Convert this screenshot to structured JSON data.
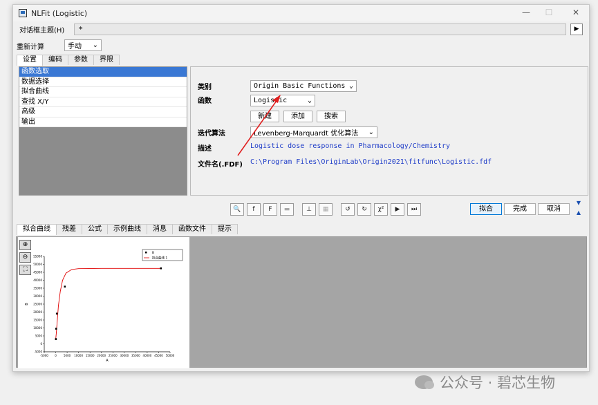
{
  "window": {
    "title": "NLFit (Logistic)",
    "minimize": "—",
    "maximize": "☐",
    "close": "✕"
  },
  "header": {
    "theme_label": "对话框主题(H)",
    "theme_value": "*",
    "recalc_label": "重新计算",
    "recalc_value": "手动"
  },
  "top_tabs": [
    "设置",
    "编码",
    "参数",
    "界限"
  ],
  "tree_items": [
    "函数选取",
    "数据选择",
    "拟合曲线",
    "查找 X/Y",
    "高级",
    "输出"
  ],
  "settings": {
    "category_label": "类别",
    "category_value": "Origin Basic Functions",
    "function_label": "函数",
    "function_value": "Logistic",
    "btn_new": "新建",
    "btn_add": "添加",
    "btn_search": "搜索",
    "algo_label": "迭代算法",
    "algo_value": "Levenberg-Marquardt 优化算法",
    "desc_label": "描述",
    "desc_value": "Logistic dose response in Pharmacology/Chemistry",
    "file_label": "文件名(.FDF)",
    "file_value": "C:\\Program Files\\OriginLab\\Origin2021\\fitfunc\\Logistic.fdf"
  },
  "actions": {
    "fit": "拟合",
    "done": "完成",
    "cancel": "取消"
  },
  "bottom_tabs": [
    "拟合曲线",
    "残差",
    "公式",
    "示例曲线",
    "消息",
    "函数文件",
    "提示"
  ],
  "watermark": "公众号 · 碧芯生物",
  "chart_data": {
    "type": "scatter",
    "xlabel": "A",
    "ylabel": "B",
    "xlim": [
      -5000,
      50000
    ],
    "ylim": [
      -5000,
      55000
    ],
    "x_ticks": [
      "-5000",
      "0",
      "5000",
      "10000",
      "15000",
      "20000",
      "25000",
      "30000",
      "35000",
      "40000",
      "45000",
      "50000"
    ],
    "y_ticks": [
      "-5000",
      "0",
      "5000",
      "10000",
      "15000",
      "20000",
      "25000",
      "30000",
      "35000",
      "40000",
      "45000",
      "50000",
      "55000"
    ],
    "legend": [
      "B",
      "拟合曲线 1"
    ],
    "points": [
      [
        100,
        3000
      ],
      [
        200,
        9500
      ],
      [
        500,
        19000
      ],
      [
        4000,
        36000
      ],
      [
        46000,
        47500
      ]
    ],
    "fit_curve": [
      [
        0,
        2500
      ],
      [
        300,
        7000
      ],
      [
        700,
        15000
      ],
      [
        1200,
        24000
      ],
      [
        2000,
        33000
      ],
      [
        3000,
        40000
      ],
      [
        4500,
        44500
      ],
      [
        7000,
        46800
      ],
      [
        10000,
        47300
      ],
      [
        20000,
        47500
      ],
      [
        46000,
        47500
      ]
    ],
    "colors": {
      "points": "#000000",
      "curve": "#e00000"
    }
  }
}
